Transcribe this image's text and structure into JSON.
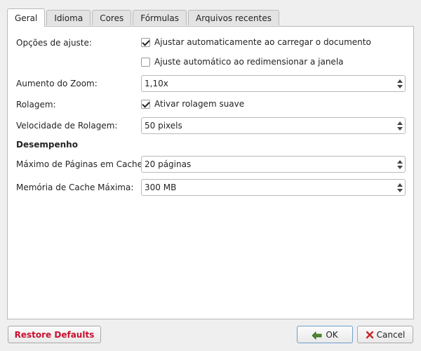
{
  "tabs": [
    {
      "label": "Geral",
      "active": true
    },
    {
      "label": "Idioma",
      "active": false
    },
    {
      "label": "Cores",
      "active": false
    },
    {
      "label": "Fórmulas",
      "active": false
    },
    {
      "label": "Arquivos recentes",
      "active": false
    }
  ],
  "general": {
    "fit_options_label": "Opções de ajuste:",
    "fit_auto_load": {
      "label": "Ajustar automaticamente ao carregar o documento",
      "checked": true
    },
    "fit_auto_resize": {
      "label": "Ajuste automático ao redimensionar a janela",
      "checked": false
    },
    "zoom_label": "Aumento do Zoom:",
    "zoom_value": "1,10x",
    "scroll_label": "Rolagem:",
    "smooth_scroll": {
      "label": "Ativar rolagem suave",
      "checked": true
    },
    "scroll_speed_label": "Velocidade de Rolagem:",
    "scroll_speed_value": "50 pixels",
    "performance_heading": "Desempenho",
    "max_cached_pages_label": "Máximo de Páginas em Cache:",
    "max_cached_pages_value": "20 páginas",
    "max_cache_memory_label": "Memória de Cache Máxima:",
    "max_cache_memory_value": "300 MB"
  },
  "buttons": {
    "restore_defaults": "Restore Defaults",
    "ok": "OK",
    "cancel": "Cancel"
  },
  "icons": {
    "ok": "check-arrow-icon",
    "cancel": "cancel-x-icon"
  },
  "colors": {
    "restore_text": "#c8102e",
    "ok_icon": "#4b8b2a",
    "cancel_icon": "#c62828"
  }
}
